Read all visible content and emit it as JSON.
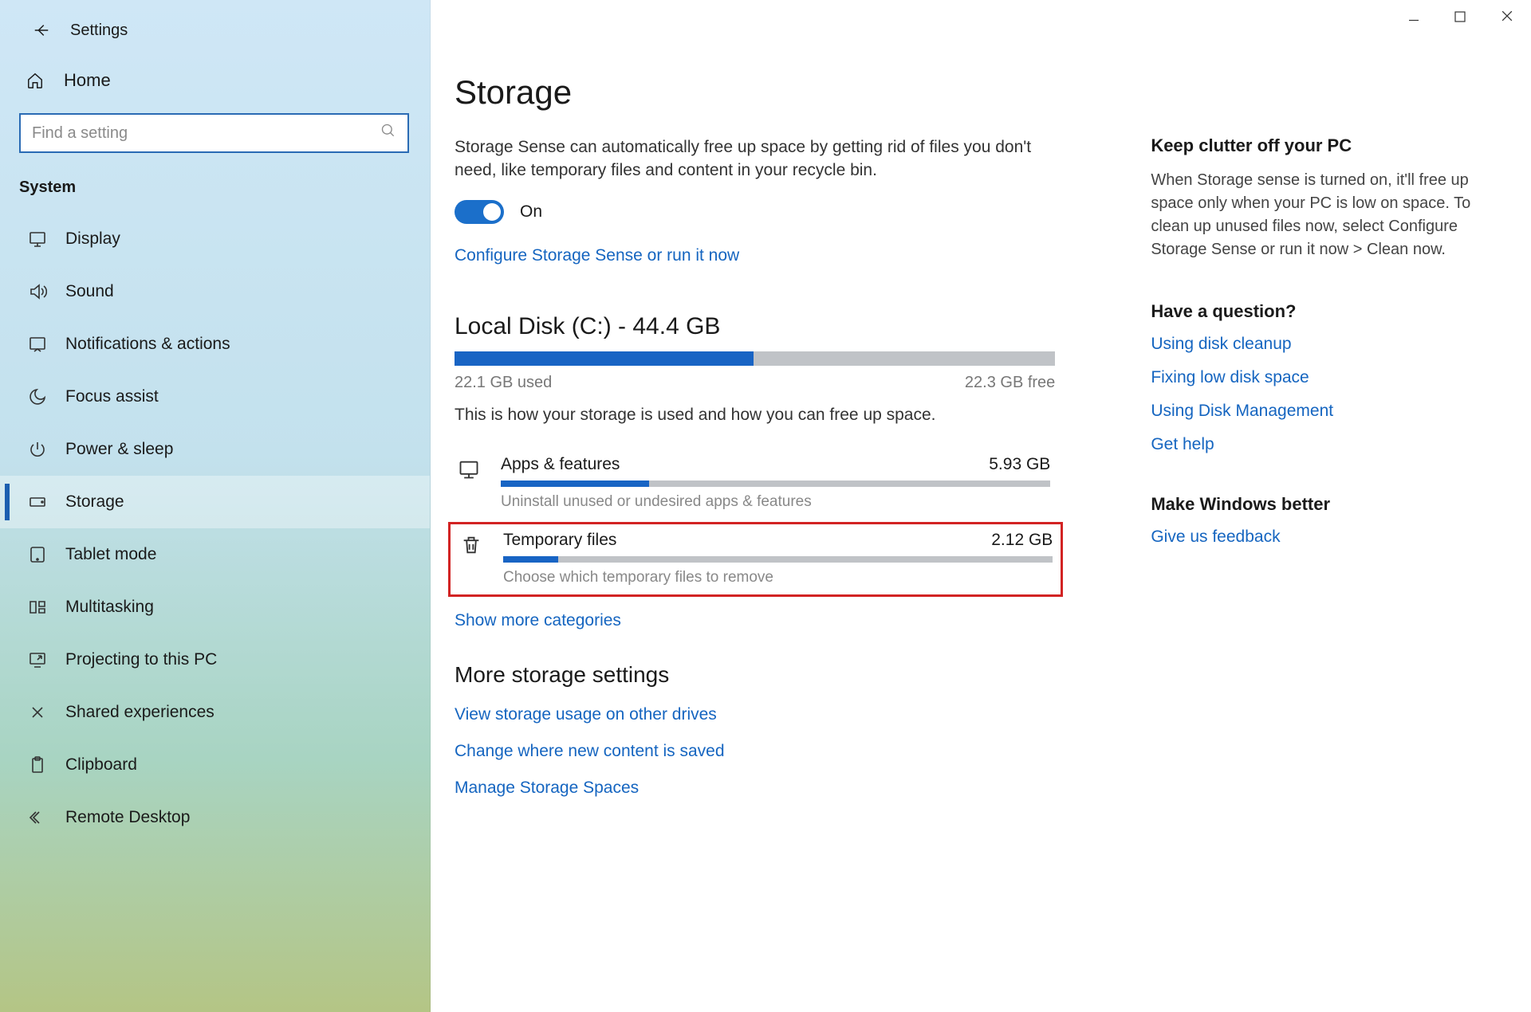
{
  "window": {
    "title": "Settings",
    "home_label": "Home",
    "search_placeholder": "Find a setting",
    "category_label": "System"
  },
  "nav": {
    "items": [
      {
        "label": "Display",
        "icon": "display-icon"
      },
      {
        "label": "Sound",
        "icon": "sound-icon"
      },
      {
        "label": "Notifications & actions",
        "icon": "notifications-icon"
      },
      {
        "label": "Focus assist",
        "icon": "focus-assist-icon"
      },
      {
        "label": "Power & sleep",
        "icon": "power-icon"
      },
      {
        "label": "Storage",
        "icon": "storage-icon",
        "selected": true
      },
      {
        "label": "Tablet mode",
        "icon": "tablet-icon"
      },
      {
        "label": "Multitasking",
        "icon": "multitasking-icon"
      },
      {
        "label": "Projecting to this PC",
        "icon": "projecting-icon"
      },
      {
        "label": "Shared experiences",
        "icon": "shared-icon"
      },
      {
        "label": "Clipboard",
        "icon": "clipboard-icon"
      },
      {
        "label": "Remote Desktop",
        "icon": "remote-icon"
      }
    ]
  },
  "page": {
    "title": "Storage",
    "sense_desc": "Storage Sense can automatically free up space by getting rid of files you don't need, like temporary files and content in your recycle bin.",
    "toggle_label": "On",
    "configure_link": "Configure Storage Sense or run it now",
    "disk_title": "Local Disk (C:) - 44.4 GB",
    "disk_used": "22.1 GB used",
    "disk_free": "22.3 GB free",
    "disk_used_pct": 49.8,
    "disk_desc": "This is how your storage is used and how you can free up space.",
    "categories": [
      {
        "name": "Apps & features",
        "size": "5.93 GB",
        "sub": "Uninstall unused or undesired apps & features",
        "pct": 27,
        "icon": "apps-icon",
        "highlight": false
      },
      {
        "name": "Temporary files",
        "size": "2.12 GB",
        "sub": "Choose which temporary files to remove",
        "pct": 10,
        "icon": "trash-icon",
        "highlight": true
      }
    ],
    "show_more": "Show more categories",
    "more_heading": "More storage settings",
    "more_links": [
      "View storage usage on other drives",
      "Change where new content is saved",
      "Manage Storage Spaces"
    ]
  },
  "aside": {
    "clutter_h": "Keep clutter off your PC",
    "clutter_text": "When Storage sense is turned on, it'll free up space only when your PC is low on space. To clean up unused files now, select Configure Storage Sense or run it now > Clean now.",
    "question_h": "Have a question?",
    "question_links": [
      "Using disk cleanup",
      "Fixing low disk space",
      "Using Disk Management",
      "Get help"
    ],
    "better_h": "Make Windows better",
    "feedback_link": "Give us feedback"
  }
}
